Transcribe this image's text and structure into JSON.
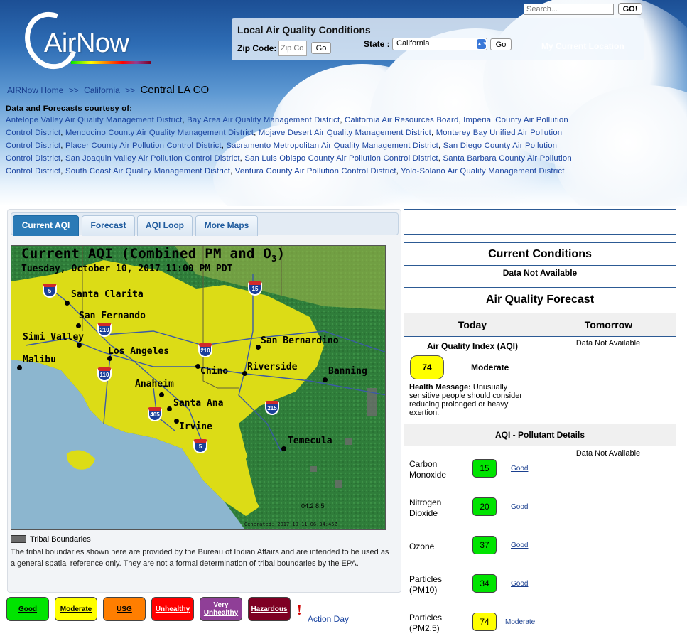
{
  "colors": {
    "good": "#00e400",
    "moderate": "#ffff00",
    "usg": "#ff7e00",
    "unhealthy": "#ff0000",
    "very_unhealthy": "#8f3f97",
    "hazardous": "#7e0023",
    "panel_border": "#2c5a94",
    "link": "#1a44a0",
    "tab_active": "#2a7ab6"
  },
  "header": {
    "logo_text": "AirNow",
    "search": {
      "placeholder": "Search...",
      "button_label": "GO!"
    },
    "local_conditions": {
      "title": "Local Air Quality Conditions",
      "zip_label": "Zip Code:",
      "zip_placeholder": "Zip Co",
      "zip_go": "Go",
      "state_label": "State :",
      "state_value": "California",
      "state_go": "Go",
      "my_location": "My Current Location"
    },
    "breadcrumb": {
      "home": "AIRNow Home",
      "sep1": ">>",
      "state": "California",
      "sep2": ">>",
      "current": "Central LA CO"
    },
    "courtesy_title": "Data and Forecasts courtesy of:",
    "agencies": [
      "Antelope Valley Air Quality Management District",
      "Bay Area Air Quality Management District",
      "California Air Resources Board",
      "Imperial County Air Pollution Control District",
      "Mendocino County Air Quality Management District",
      "Mojave Desert Air Quality Management District",
      "Monterey Bay Unified Air Pollution Control District",
      "Placer County Air Pollution Control District",
      "Sacramento Metropolitan Air Quality Management District",
      "San Diego County Air Pollution Control District",
      "San Joaquin Valley Air Pollution Control District",
      "San Luis Obispo County Air Pollution Control District",
      "Santa Barbara County Air Pollution Control District",
      "South Coast Air Quality Management District",
      "Ventura County Air Pollution Control District",
      "Yolo-Solano Air Quality Management District"
    ]
  },
  "tabs": [
    "Current AQI",
    "Forecast",
    "AQI Loop",
    "More Maps"
  ],
  "map": {
    "title": "Current AQI (Combined PM and O",
    "title_sub": "3",
    "title_end": ")",
    "date": "Tuesday, October 10, 2017 11:00 PM PDT",
    "cities": [
      "Santa Clarita",
      "San Fernando",
      "Simi Valley",
      "Malibu",
      "Los Angeles",
      "San Bernardino",
      "Chino",
      "Riverside",
      "Banning",
      "Anaheim",
      "Santa Ana",
      "Irvine",
      "Temecula"
    ],
    "highways": [
      "5",
      "15",
      "210",
      "210",
      "110",
      "405",
      "215",
      "5"
    ],
    "scale_text": "04.2 8.5",
    "generated": "Generated: 2017-10-11 06:34:45Z"
  },
  "tribal": {
    "label": "Tribal Boundaries",
    "note": "The tribal boundaries shown here are provided by the Bureau of Indian Affairs and are intended to be used as a general spatial reference only. They are not a formal determination of tribal boundaries by the EPA."
  },
  "legend": {
    "good": "Good",
    "moderate": "Moderate",
    "usg": "USG",
    "unhealthy": "Unhealthy",
    "very_unhealthy_1": "Very",
    "very_unhealthy_2": "Unhealthy",
    "hazardous": "Hazardous",
    "action_icon": "!",
    "action_day": "Action Day"
  },
  "current_conditions": {
    "title": "Current Conditions",
    "status": "Data Not Available"
  },
  "forecast": {
    "title": "Air Quality Forecast",
    "today_label": "Today",
    "tomorrow_label": "Tomorrow",
    "aqi_label": "Air Quality Index (AQI)",
    "aqi_value": "74",
    "aqi_category": "Moderate",
    "health_label": "Health Message:",
    "health_text": "Unusually sensitive people should consider reducing prolonged or heavy exertion.",
    "tomorrow_status": "Data Not Available",
    "pollutant_header": "AQI - Pollutant Details",
    "pollutant_tomorrow_status": "Data Not Available",
    "pollutants": [
      {
        "name1": "Carbon",
        "name2": "Monoxide",
        "value": "15",
        "category": "Good"
      },
      {
        "name1": "Nitrogen",
        "name2": "Dioxide",
        "value": "20",
        "category": "Good"
      },
      {
        "name1": "Ozone",
        "name2": "",
        "value": "37",
        "category": "Good"
      },
      {
        "name1": "Particles",
        "name2": "(PM10)",
        "value": "34",
        "category": "Good"
      },
      {
        "name1": "Particles",
        "name2": "(PM2.5)",
        "value": "74",
        "category": "Moderate"
      }
    ]
  }
}
